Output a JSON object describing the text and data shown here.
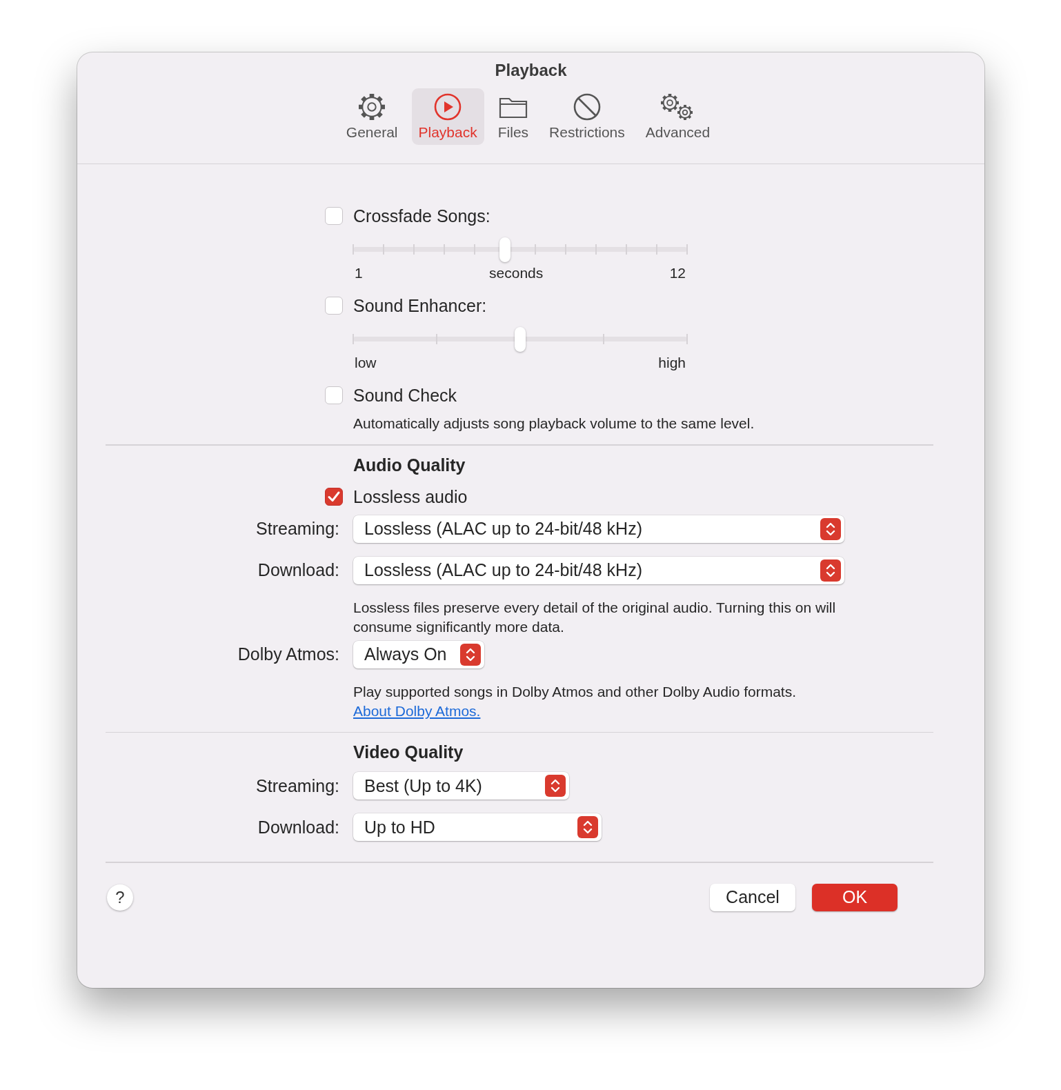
{
  "window": {
    "title": "Playback"
  },
  "tabs": [
    {
      "label": "General",
      "selected": false
    },
    {
      "label": "Playback",
      "selected": true
    },
    {
      "label": "Files",
      "selected": false
    },
    {
      "label": "Restrictions",
      "selected": false
    },
    {
      "label": "Advanced",
      "selected": false
    }
  ],
  "sections": [
    {
      "items": [
        {
          "kind": "checkbox",
          "label": "Crossfade Songs:",
          "checked": false
        },
        {
          "kind": "slider",
          "level": 0.4545,
          "min_label": "1",
          "mid_label": "seconds",
          "max_label": "12"
        },
        {
          "kind": "checkbox",
          "label": "Sound Enhancer:",
          "checked": false
        },
        {
          "kind": "slider",
          "level": 0.5,
          "min_label": "low",
          "max_label": "high"
        },
        {
          "kind": "checkbox",
          "label": "Sound Check",
          "checked": false
        },
        {
          "kind": "note",
          "text": "Automatically adjusts song playback volume to the same level."
        }
      ]
    },
    {
      "heading": "Audio Quality",
      "items": [
        {
          "kind": "checkbox",
          "label": "Lossless audio",
          "checked": true
        },
        {
          "kind": "select",
          "label": "Streaming:",
          "value": "Lossless (ALAC up to 24-bit/48 kHz)"
        },
        {
          "kind": "select",
          "label": "Download:",
          "value": "Lossless (ALAC up to 24-bit/48 kHz)"
        },
        {
          "kind": "note",
          "text": "Lossless files preserve every detail of the original audio. Turning this on will consume significantly more data."
        },
        {
          "kind": "select",
          "label": "Dolby Atmos:",
          "value": "Always On"
        },
        {
          "kind": "note",
          "text": "Play supported songs in Dolby Atmos and other Dolby Audio formats.",
          "link": "About Dolby Atmos."
        }
      ]
    },
    {
      "heading": "Video Quality",
      "items": [
        {
          "kind": "select",
          "label": "Streaming:",
          "value": "Best (Up to 4K)"
        },
        {
          "kind": "select",
          "label": "Download:",
          "value": "Up to HD"
        }
      ]
    }
  ],
  "footer": {
    "help": "?",
    "buttons": [
      {
        "label": "Cancel",
        "kind": "default"
      },
      {
        "label": "OK",
        "kind": "primary"
      }
    ]
  }
}
